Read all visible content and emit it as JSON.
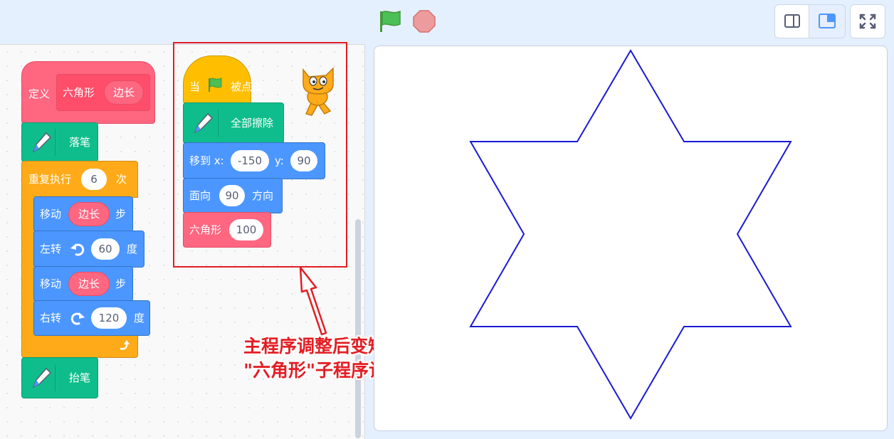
{
  "toolbar": {
    "green_flag_icon": "green-flag-icon",
    "stop_icon": "stop-icon",
    "small_stage_icon": "small-stage-icon",
    "normal_stage_icon": "normal-stage-icon",
    "fullscreen_icon": "fullscreen-icon"
  },
  "define_script": {
    "define_label": "定义",
    "proc_name": "六角形",
    "param_name": "边长",
    "pen_down_label": "落笔",
    "repeat_label": "重复执行",
    "repeat_count": "6",
    "repeat_unit": "次",
    "move1_label": "移动",
    "move1_arg": "边长",
    "move1_unit": "步",
    "turn_left_label": "左转",
    "turn_left_value": "60",
    "turn_left_unit": "度",
    "move2_label": "移动",
    "move2_arg": "边长",
    "move2_unit": "步",
    "turn_right_label": "右转",
    "turn_right_value": "120",
    "turn_right_unit": "度",
    "pen_up_label": "抬笔"
  },
  "main_script": {
    "hat_when": "当",
    "hat_clicked": "被点击",
    "erase_label": "全部擦除",
    "goto_label": "移到 x:",
    "goto_x": "-150",
    "goto_y_label": "y:",
    "goto_y": "90",
    "direction_label": "面向",
    "direction_value": "90",
    "direction_unit": "方向",
    "call_label": "六角形",
    "call_value": "100"
  },
  "annotation": {
    "line1": "主程序调整后变短了",
    "line2": "\"六角形\"子程序让逻辑更清晰"
  },
  "colors": {
    "events": "#ffbf00",
    "pen": "#0fbd8c",
    "motion": "#4c97ff",
    "control": "#ffab19",
    "custom": "#ff6680",
    "star_stroke": "#1a1ad6",
    "annotation": "#e31e24"
  }
}
